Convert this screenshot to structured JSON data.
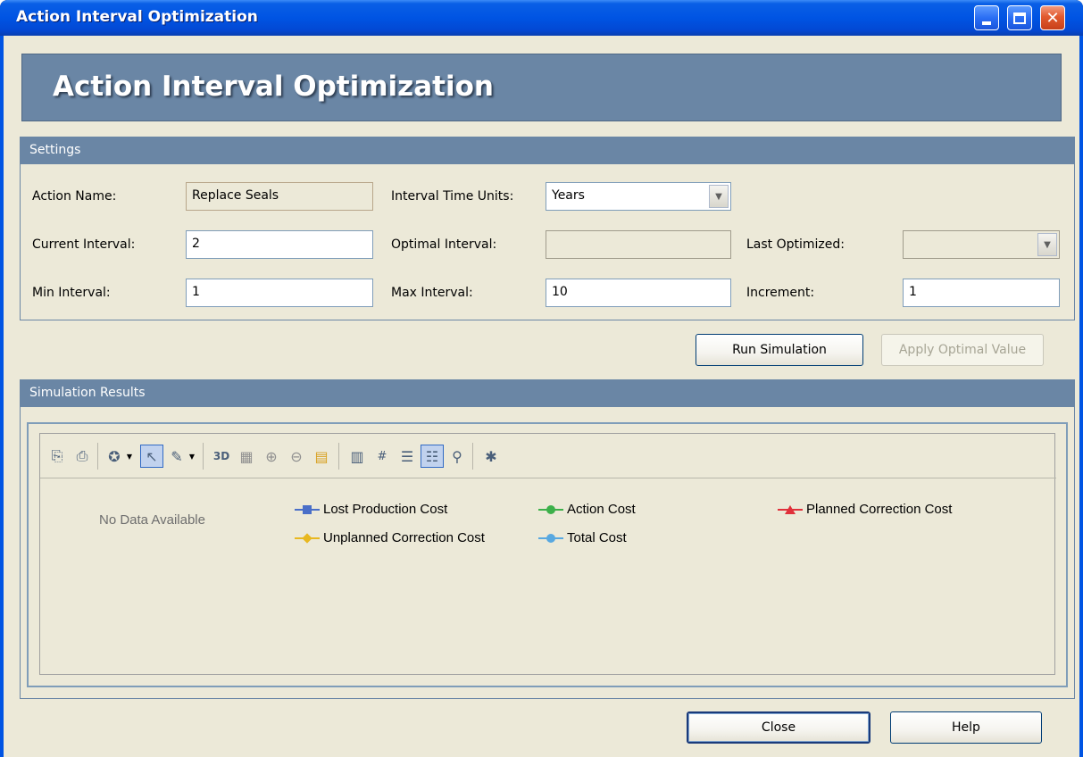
{
  "window": {
    "title": "Action Interval Optimization"
  },
  "banner": {
    "title": "Action Interval Optimization"
  },
  "settings": {
    "header": "Settings",
    "action_name": {
      "label": "Action Name:",
      "value": "Replace Seals"
    },
    "interval_time_units": {
      "label": "Interval Time Units:",
      "value": "Years"
    },
    "current_interval": {
      "label": "Current Interval:",
      "value": "2"
    },
    "optimal_interval": {
      "label": "Optimal Interval:",
      "value": ""
    },
    "last_optimized": {
      "label": "Last Optimized:",
      "value": ""
    },
    "min_interval": {
      "label": "Min Interval:",
      "value": "1"
    },
    "max_interval": {
      "label": "Max Interval:",
      "value": "10"
    },
    "increment": {
      "label": "Increment:",
      "value": "1"
    }
  },
  "actions": {
    "run_simulation": "Run Simulation",
    "apply_optimal_value": "Apply Optimal Value"
  },
  "results": {
    "header": "Simulation Results",
    "no_data": "No Data Available",
    "toolbar_icons": [
      "copy-icon",
      "print-icon",
      "chart-type-icon",
      "pointer-icon",
      "palette-icon",
      "3d-icon",
      "grid-icon",
      "vertical-axis-icon",
      "horizontal-axis-icon",
      "export-icon",
      "data-grid-icon",
      "data-labels-icon",
      "properties-icon",
      "legend-icon",
      "zoom-icon",
      "wizard-icon"
    ]
  },
  "chart_data": {
    "type": "line",
    "series": [
      {
        "name": "Lost Production Cost",
        "color": "#4a6fc8",
        "marker": "square",
        "values": []
      },
      {
        "name": "Action Cost",
        "color": "#3cb04a",
        "marker": "circle",
        "values": []
      },
      {
        "name": "Planned Correction Cost",
        "color": "#e0303a",
        "marker": "triangle",
        "values": []
      },
      {
        "name": "Unplanned Correction Cost",
        "color": "#e8b820",
        "marker": "diamond",
        "values": []
      },
      {
        "name": "Total Cost",
        "color": "#58a8e0",
        "marker": "circle",
        "values": []
      }
    ]
  },
  "footer": {
    "close": "Close",
    "help": "Help"
  }
}
